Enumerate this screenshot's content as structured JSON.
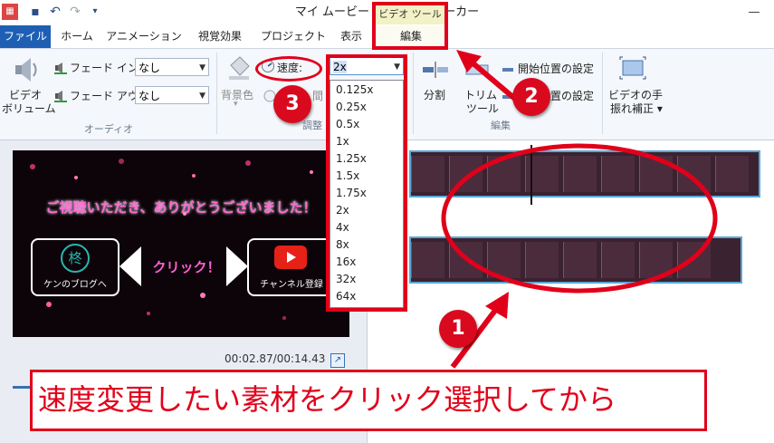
{
  "window": {
    "title": "マイ ムービー - ムービー メーカー",
    "contextual_tab_header": "ビデオ ツール"
  },
  "tabs": [
    "ファイル",
    "ホーム",
    "アニメーション",
    "視覚効果",
    "プロジェクト",
    "表示",
    "編集"
  ],
  "audio_group": {
    "video_volume_label_1": "ビデオ",
    "video_volume_label_2": "ボリューム",
    "fade_in_label": "フェード イン:",
    "fade_in_value": "なし",
    "fade_out_label": "フェード アウト:",
    "fade_out_value": "なし",
    "group_label": "オーディオ"
  },
  "adjust_group": {
    "background_color_label": "背景色",
    "speed_label": "速度:",
    "speed_value": "2x",
    "group_label": "調整",
    "partial_label": "間"
  },
  "speed_options": [
    "0.125x",
    "0.25x",
    "0.5x",
    "1x",
    "1.25x",
    "1.5x",
    "1.75x",
    "2x",
    "4x",
    "8x",
    "16x",
    "32x",
    "64x"
  ],
  "edit_group": {
    "split_label": "分割",
    "trim_tool_label_1": "トリム",
    "trim_tool_label_2": "ツール",
    "set_start_label": "開始位置の設定",
    "set_end_label_partial": "置の設定",
    "group_label": "編集"
  },
  "stabilization": {
    "label_1": "ビデオの手",
    "label_2": "振れ補正"
  },
  "preview": {
    "headline": "ご視聴いただき、ありがとうございました！",
    "blog_label": "ケンのブログへ",
    "click_label": "クリック！",
    "channel_label": "チャンネル登録",
    "emblem_char": "柊",
    "timecode": "00:02.87/00:14.43"
  },
  "annotations": {
    "badge_1": "1",
    "badge_2": "2",
    "badge_3": "3",
    "caption": "速度変更したい素材をクリック選択してから"
  },
  "colors": {
    "annotation_red": "#e1001a",
    "file_tab_blue": "#1e5fb4",
    "accent_pink": "#ff5fd6"
  }
}
